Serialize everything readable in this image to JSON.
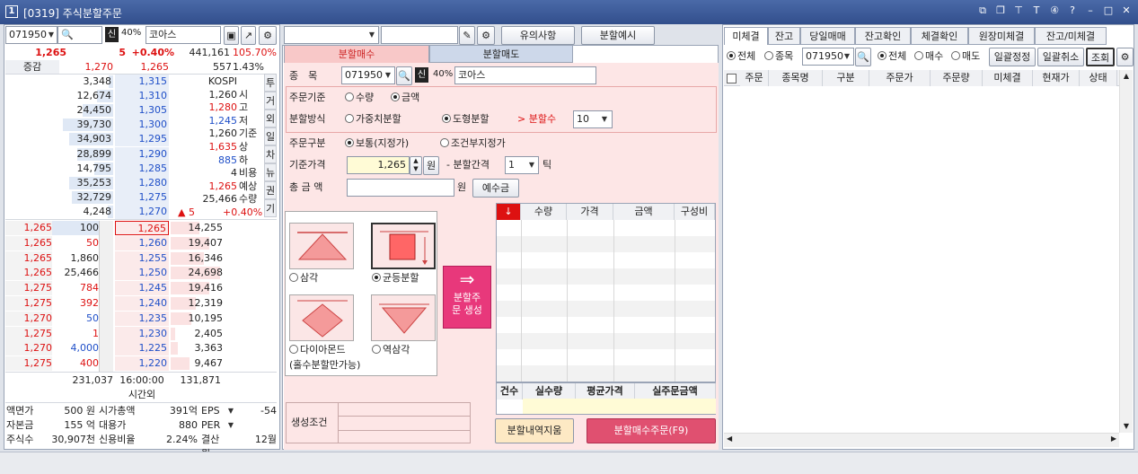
{
  "window": {
    "code": "[0319]",
    "title": "주식분할주문",
    "num": "1"
  },
  "left": {
    "code_value": "071950",
    "type_badge": "신",
    "margin": "40%",
    "stock_name": "코아스",
    "price_row": {
      "price": "1,265",
      "change": "5",
      "rate": "+0.40%",
      "volume": "441,161",
      "vol_rate": "105.70%"
    },
    "sub_row": {
      "label": "증감",
      "val1": "1,270",
      "val2": "1,265",
      "val3": "557",
      "val4": "1.43%"
    },
    "ask_rows": [
      {
        "qty": "3,348",
        "price": "1,315"
      },
      {
        "qty": "12,674",
        "price": "1,310"
      },
      {
        "qty": "24,450",
        "price": "1,305"
      },
      {
        "qty": "39,730",
        "price": "1,300"
      },
      {
        "qty": "34,903",
        "price": "1,295"
      },
      {
        "qty": "28,899",
        "price": "1,290"
      },
      {
        "qty": "14,795",
        "price": "1,285"
      },
      {
        "qty": "35,253",
        "price": "1,280"
      },
      {
        "qty": "32,729",
        "price": "1,275"
      },
      {
        "qty": "4,248",
        "price": "1,270"
      }
    ],
    "info_rows": [
      {
        "val": "KOSPI",
        "lab": "",
        "cls": ""
      },
      {
        "val": "1,260",
        "lab": "시",
        "cls": ""
      },
      {
        "val": "1,280",
        "lab": "고",
        "cls": "red"
      },
      {
        "val": "1,245",
        "lab": "저",
        "cls": "blue"
      },
      {
        "val": "1,260",
        "lab": "기준",
        "cls": ""
      },
      {
        "val": "1,635",
        "lab": "상",
        "cls": "red"
      },
      {
        "val": "885",
        "lab": "하",
        "cls": "blue"
      },
      {
        "val": "4",
        "lab": "비용",
        "cls": ""
      },
      {
        "val": "1,265",
        "lab": "예상",
        "cls": "red"
      },
      {
        "val": "25,466",
        "lab": "수량",
        "cls": ""
      }
    ],
    "exp_change": "▲ 5",
    "exp_rate": "+0.40%",
    "side_tabs": [
      "투",
      "거",
      "외",
      "일",
      "차",
      "뉴",
      "권",
      "기"
    ],
    "trade_rows": [
      {
        "p": "1,265",
        "q": "100",
        "c": ""
      },
      {
        "p": "1,265",
        "q": "50",
        "c": "red"
      },
      {
        "p": "1,265",
        "q": "1,860",
        "c": ""
      },
      {
        "p": "1,265",
        "q": "25,466",
        "c": ""
      },
      {
        "p": "1,275",
        "q": "784",
        "c": "red"
      },
      {
        "p": "1,275",
        "q": "392",
        "c": "red"
      },
      {
        "p": "1,270",
        "q": "50",
        "c": "blue"
      },
      {
        "p": "1,275",
        "q": "1",
        "c": "red"
      },
      {
        "p": "1,270",
        "q": "4,000",
        "c": "blue"
      },
      {
        "p": "1,275",
        "q": "400",
        "c": "red"
      }
    ],
    "bid_rows": [
      {
        "price": "1,265",
        "qty": "14,255"
      },
      {
        "price": "1,260",
        "qty": "19,407"
      },
      {
        "price": "1,255",
        "qty": "16,346"
      },
      {
        "price": "1,250",
        "qty": "24,698"
      },
      {
        "price": "1,245",
        "qty": "19,416"
      },
      {
        "price": "1,240",
        "qty": "12,319"
      },
      {
        "price": "1,235",
        "qty": "10,195"
      },
      {
        "price": "1,230",
        "qty": "2,405"
      },
      {
        "price": "1,225",
        "qty": "3,363"
      },
      {
        "price": "1,220",
        "qty": "9,467"
      }
    ],
    "totals": {
      "ask": "231,037",
      "time": "16:00:00",
      "bid": "131,871",
      "time_label": "시간외"
    },
    "bottom": [
      {
        "l1": "액면가",
        "v1": "500 원",
        "l2": "시가총액",
        "v2": "391억",
        "l3": "EPS",
        "v3": "-54"
      },
      {
        "l1": "자본금",
        "v1": "155 억",
        "l2": "대용가",
        "v2": "880",
        "l3": "PER",
        "v3": ""
      },
      {
        "l1": "주식수",
        "v1": "30,907천",
        "l2": "신용비율",
        "v2": "2.24%",
        "l3": "결산월",
        "v3": "12월"
      }
    ]
  },
  "middle": {
    "warning_btn": "유의사항",
    "example_btn": "분할예시",
    "tab_buy": "분할매수",
    "tab_sell": "분할매도",
    "item_label": "종　목",
    "code_value": "071950",
    "type_badge": "신",
    "margin": "40%",
    "stock_name": "코아스",
    "order_basis_label": "주문기준",
    "opt_qty": "수량",
    "opt_amount": "금액",
    "split_method_label": "분할방식",
    "opt_weighted": "가중치분할",
    "opt_shape": "도형분할",
    "split_count_label": "> 분할수",
    "split_count": "10",
    "order_type_label": "주문구분",
    "opt_normal": "보통(지정가)",
    "opt_conditional": "조건부지정가",
    "base_price_label": "기준가격",
    "base_price": "1,265",
    "won": "원",
    "interval_label": "- 분할간격",
    "interval": "1",
    "tick": "틱",
    "total_label": "총 금 액",
    "total_won": "원",
    "deposit_btn": "예수금",
    "patterns": {
      "triangle": "삼각",
      "equal": "균등분할",
      "diamond": "다이아몬드",
      "inverse": "역삼각",
      "note": "(홀수분할만가능)"
    },
    "generate_btn": "분할주문 생성",
    "table_headers": [
      "↓",
      "수량",
      "가격",
      "금액",
      "구성비"
    ],
    "summary_headers": [
      "건수",
      "실수량",
      "평균가격",
      "실주문금액"
    ],
    "condition_label": "생성조건",
    "clear_btn": "분할내역지움",
    "order_btn": "분할매수주문(F9)"
  },
  "right": {
    "tabs": [
      "미체결",
      "잔고",
      "당일매매",
      "잔고확인",
      "체결확인",
      "원장미체결",
      "잔고/미체결"
    ],
    "opt_all": "전체",
    "opt_item": "종목",
    "code_value": "071950",
    "opt_all2": "전체",
    "opt_buy": "매수",
    "opt_sell": "매도",
    "batch_edit": "일괄정정",
    "batch_cancel": "일괄취소",
    "query_btn": "조회",
    "headers": [
      "주문",
      "종목명",
      "구분",
      "주문가",
      "주문량",
      "미체결",
      "현재가",
      "상태"
    ]
  },
  "colors": {
    "up": "#d11",
    "down": "#1f4fc8",
    "accent": "#e8387b"
  }
}
